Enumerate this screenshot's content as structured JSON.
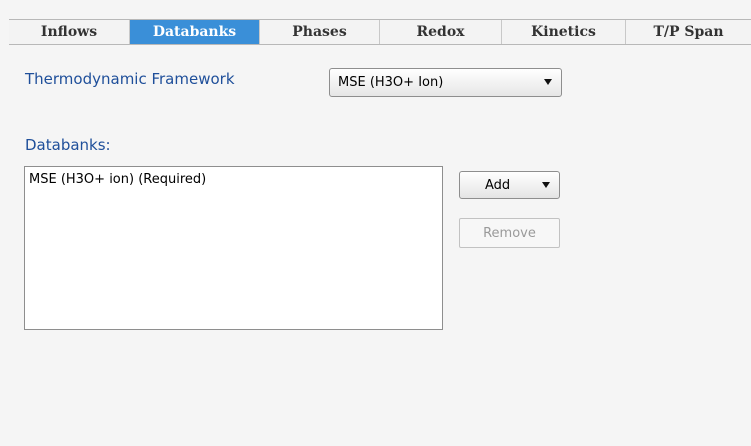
{
  "tabs": [
    {
      "label": "Inflows",
      "active": false
    },
    {
      "label": "Databanks",
      "active": true
    },
    {
      "label": "Phases",
      "active": false
    },
    {
      "label": "Redox",
      "active": false
    },
    {
      "label": "Kinetics",
      "active": false
    },
    {
      "label": "T/P Span",
      "active": false
    }
  ],
  "framework": {
    "label": "Thermodynamic Framework",
    "selected": "MSE (H3O+ Ion)"
  },
  "databanks": {
    "label": "Databanks:",
    "items": [
      "MSE (H3O+ ion) (Required)"
    ]
  },
  "buttons": {
    "add_label": "Add",
    "remove_label": "Remove",
    "remove_enabled": false
  },
  "colors": {
    "active_tab": "#3a8fd8",
    "label_blue": "#1f4f9a"
  }
}
